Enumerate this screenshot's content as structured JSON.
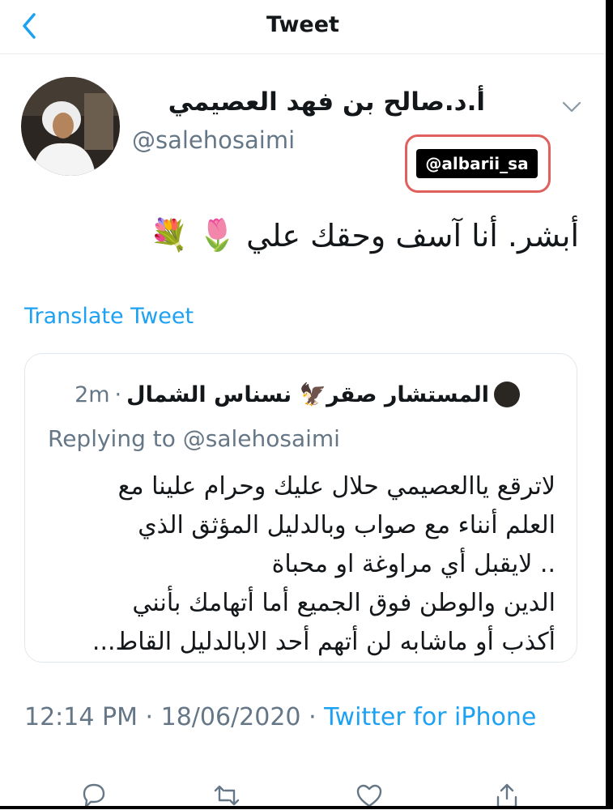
{
  "header": {
    "title": "Tweet"
  },
  "author": {
    "name": "أ.د.صالح بن فهد العصيمي",
    "handle": "@salehosaimi"
  },
  "overlay_label": "@albarii_sa",
  "tweet": {
    "text": "أبشر. أنا آسف وحقك علي",
    "emojis": "🌷 💐"
  },
  "translate_label": "Translate Tweet",
  "quoted_tweet": {
    "name": "المستشار صقر🦅 نسناس الشمال",
    "separator": "·",
    "time": "2m",
    "replying_to": "Replying to @salehosaimi",
    "lines": [
      "لاترقع ياالعصيمي حلال عليك وحرام علينا مع",
      "العلم أنناء مع صواب وبالدليل المؤثق الذي",
      ".. لايقبل أي مراوغة او محباة",
      "الدين والوطن فوق الجميع أما أتهامك بأنني",
      "أكذب أو ماشابه لن أتهم أحد الابالدليل القاط..."
    ]
  },
  "meta": {
    "time": "12:14 PM",
    "date": "18/06/2020",
    "separator": "·",
    "source": "Twitter for iPhone"
  },
  "icons": {
    "back": "chevron-left-icon",
    "menu": "chevron-down-icon",
    "reply": "reply-icon",
    "retweet": "retweet-icon",
    "like": "heart-icon",
    "share": "share-icon"
  },
  "colors": {
    "accent": "#1da1f2",
    "muted": "#657786",
    "text": "#14171a",
    "highlight_border": "#e0605e"
  }
}
